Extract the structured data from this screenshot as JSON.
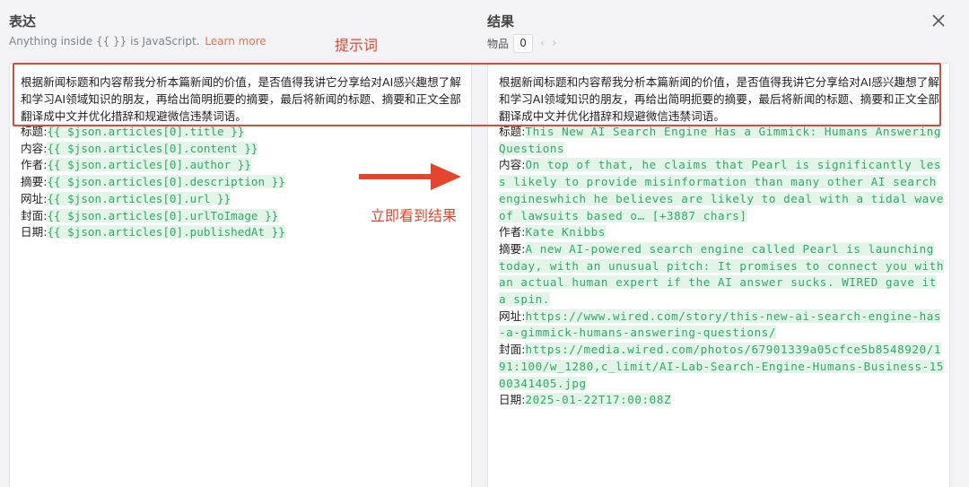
{
  "left": {
    "title": "表达",
    "hint": "Anything inside {{  }} is JavaScript.",
    "learn_more": "Learn more"
  },
  "right": {
    "title": "结果",
    "item_label": "物品",
    "item_value": "0"
  },
  "annotations": {
    "prompt_label": "提示词",
    "result_label": "立即看到结果"
  },
  "prompt_text": "根据新闻标题和内容帮我分析本篇新闻的价值，是否值得我讲它分享给对AI感兴趣想了解和学习AI领域知识的朋友，再给出简明扼要的摘要，最后将新闻的标题、摘要和正文全部翻译成中文并优化措辞和规避微信违禁词语。",
  "expressions": [
    {
      "label": "标题:",
      "expr": "{{ $json.articles[0].title }}"
    },
    {
      "label": "内容:",
      "expr": "{{ $json.articles[0].content }}"
    },
    {
      "label": "作者:",
      "expr": "{{ $json.articles[0].author }}"
    },
    {
      "label": "摘要:",
      "expr": "{{ $json.articles[0].description }}"
    },
    {
      "label": "网址:",
      "expr": "{{ $json.articles[0].url }}"
    },
    {
      "label": "封面:",
      "expr": "{{ $json.articles[0].urlToImage }}"
    },
    {
      "label": "日期:",
      "expr": "{{ $json.articles[0].publishedAt }}"
    }
  ],
  "results": [
    {
      "label": "标题:",
      "value": "This New AI Search Engine Has a Gimmick: Humans Answering Questions"
    },
    {
      "label": "内容:",
      "value": "On top of that, he claims that Pearl is significantly less likely to provide misinformation than many other AI search engineswhich he believes are likely to deal with a tidal wave of lawsuits based o… [+3887 chars]"
    },
    {
      "label": "作者:",
      "value": "Kate Knibbs"
    },
    {
      "label": "摘要:",
      "value": "A new AI-powered search engine called Pearl is launching today, with an unusual pitch: It promises to connect you with an actual human expert if the AI answer sucks. WIRED gave it a spin."
    },
    {
      "label": "网址:",
      "value": "https://www.wired.com/story/this-new-ai-search-engine-has-a-gimmick-humans-answering-questions/"
    },
    {
      "label": "封面:",
      "value": "https://media.wired.com/photos/67901339a05cfce5b8548920/191:100/w_1280,c_limit/AI-Lab-Search-Engine-Humans-Business-1500341405.jpg"
    },
    {
      "label": "日期:",
      "value": "2025-01-22T17:00:08Z"
    }
  ],
  "colors": {
    "annotation": "#e5452c",
    "code_text": "#35a86a",
    "code_bg": "#e3f4e8"
  },
  "icons": [
    "chevron-left-icon",
    "chevron-right-icon",
    "close-icon",
    "arrow-right-icon"
  ]
}
